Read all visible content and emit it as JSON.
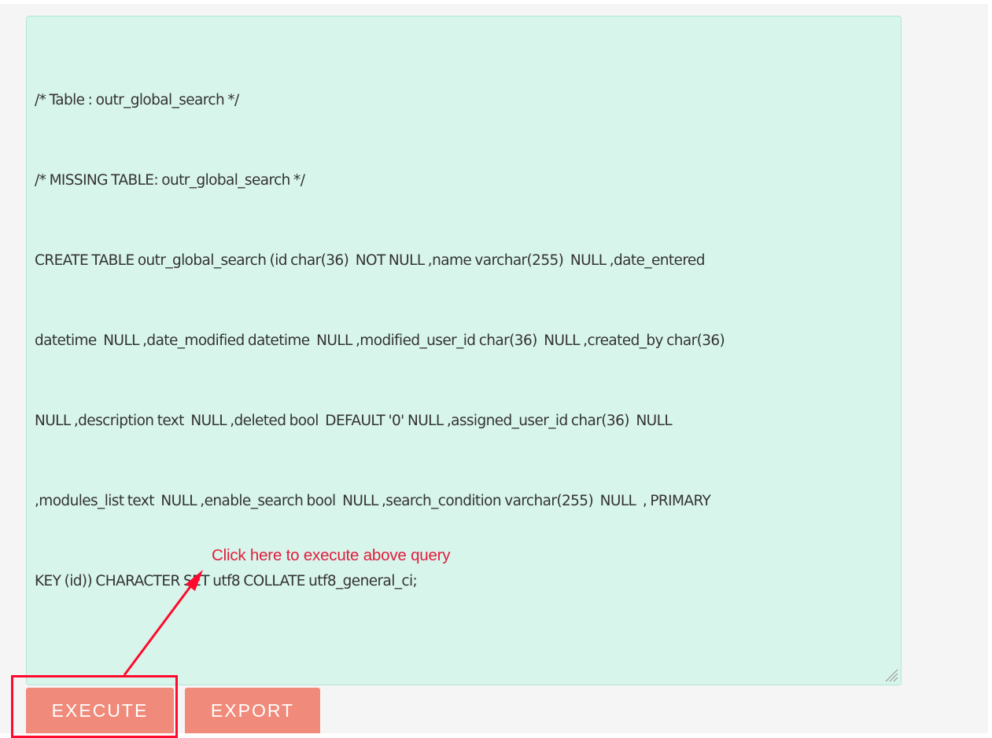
{
  "query_editor": {
    "lines": [
      "/* Table : outr_global_search */",
      "/* MISSING TABLE: outr_global_search */",
      "CREATE TABLE outr_global_search (id char(36)  NOT NULL ,name varchar(255)  NULL ,date_entered",
      "datetime  NULL ,date_modified datetime  NULL ,modified_user_id char(36)  NULL ,created_by char(36)",
      "NULL ,description text  NULL ,deleted bool  DEFAULT '0' NULL ,assigned_user_id char(36)  NULL",
      ",modules_list text  NULL ,enable_search bool  NULL ,search_condition varchar(255)  NULL  , PRIMARY",
      "KEY (id)) CHARACTER SET utf8 COLLATE utf8_general_ci;"
    ]
  },
  "annotation": {
    "text": "Click here to execute above query",
    "color": "#e11d3c"
  },
  "buttons": {
    "execute_label": "EXECUTE",
    "export_label": "EXPORT",
    "color": "#f08a7a"
  }
}
